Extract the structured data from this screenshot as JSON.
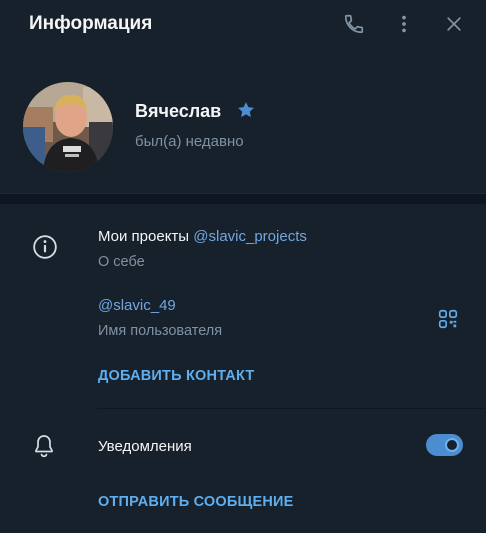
{
  "header": {
    "title": "Информация",
    "icons": [
      "phone-icon",
      "more-vertical-icon",
      "close-icon"
    ]
  },
  "profile": {
    "name": "Вячеслав",
    "badge_icon": "star-icon",
    "status": "был(а) недавно"
  },
  "info": {
    "icon": "info-icon",
    "bio_prefix": "Мои проекты ",
    "bio_link": "@slavic_projects",
    "bio_label": "О себе",
    "username": "@slavic_49",
    "username_label": "Имя пользователя",
    "qr_icon": "qr-code-icon",
    "add_contact": "ДОБАВИТЬ КОНТАКТ"
  },
  "notifications": {
    "icon": "bell-icon",
    "label": "Уведомления",
    "enabled": true
  },
  "actions": {
    "send_message": "ОТПРАВИТЬ СООБЩЕНИЕ"
  },
  "colors": {
    "background": "#17212b",
    "separator": "#0e1621",
    "accent": "#5eaef0",
    "link": "#71a7e0",
    "muted_text": "#7f91a4",
    "toggle_on": "#4c8dd1"
  }
}
